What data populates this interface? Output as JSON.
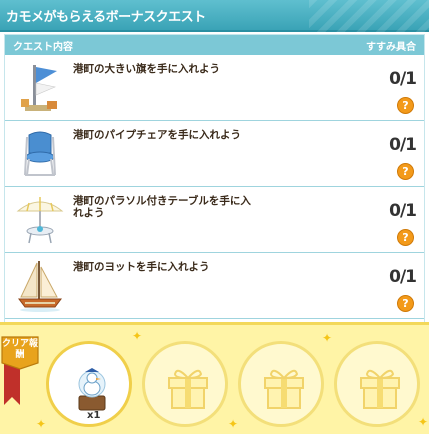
{
  "title": "カモメがもらえるボーナスクエスト",
  "columns": {
    "left": "クエスト内容",
    "right": "すすみ具合"
  },
  "quests": [
    {
      "text": "港町の大きい旗を手に入れよう",
      "progress": "0/1",
      "help": "?",
      "icon": "flag-icon"
    },
    {
      "text": "港町のパイプチェアを手に入れよう",
      "progress": "0/1",
      "help": "?",
      "icon": "chair-icon"
    },
    {
      "text": "港町のパラソル付きテーブルを手に入れよう",
      "progress": "0/1",
      "help": "?",
      "icon": "parasol-table-icon"
    },
    {
      "text": "港町のヨットを手に入れよう",
      "progress": "0/1",
      "help": "?",
      "icon": "yacht-icon"
    }
  ],
  "reward": {
    "badge": "クリア報酬",
    "count": "x1",
    "slots": [
      "seagull-reward-icon",
      "gift-icon",
      "gift-icon",
      "gift-icon"
    ]
  },
  "colors": {
    "header": "#3aa3b6",
    "reward_bg": "#fff4a6",
    "help": "#f39a1a"
  }
}
